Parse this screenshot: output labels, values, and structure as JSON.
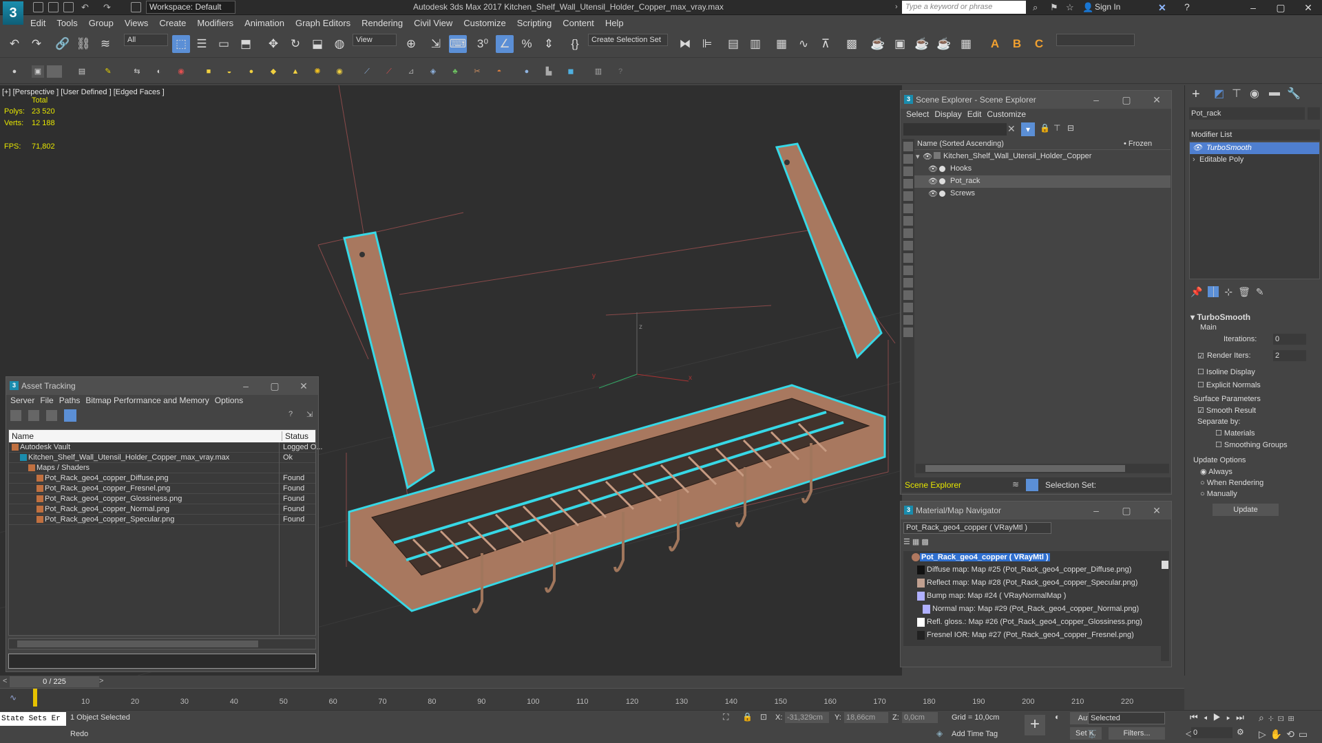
{
  "titlebar": {
    "workspace": "Workspace: Default",
    "title": "Autodesk 3ds Max 2017     Kitchen_Shelf_Wall_Utensil_Holder_Copper_max_vray.max",
    "search_placeholder": "Type a keyword or phrase",
    "signin": "Sign In"
  },
  "menu": [
    "Edit",
    "Tools",
    "Group",
    "Views",
    "Create",
    "Modifiers",
    "Animation",
    "Graph Editors",
    "Rendering",
    "Civil View",
    "Customize",
    "Scripting",
    "Content",
    "Help"
  ],
  "toolbar": {
    "filter": "All",
    "ref_coord": "View",
    "selection_set": "Create Selection Set"
  },
  "viewport": {
    "label": "[+] [Perspective ] [User Defined ] [Edged Faces ]",
    "total_label": "Total",
    "polys_label": "Polys:",
    "polys_value": "23 520",
    "verts_label": "Verts:",
    "verts_value": "12 188",
    "fps_label": "FPS:",
    "fps_value": "71,802"
  },
  "asset_tracking": {
    "title": "Asset Tracking",
    "menus": [
      "Server",
      "File",
      "Paths",
      "Bitmap Performance and Memory",
      "Options"
    ],
    "col_name": "Name",
    "col_status": "Status",
    "rows": [
      {
        "indent": 0,
        "name": "Autodesk Vault",
        "status": "Logged O..."
      },
      {
        "indent": 1,
        "name": "Kitchen_Shelf_Wall_Utensil_Holder_Copper_max_vray.max",
        "status": "Ok"
      },
      {
        "indent": 2,
        "name": "Maps / Shaders",
        "status": ""
      },
      {
        "indent": 3,
        "name": "Pot_Rack_geo4_copper_Diffuse.png",
        "status": "Found"
      },
      {
        "indent": 3,
        "name": "Pot_Rack_geo4_copper_Fresnel.png",
        "status": "Found"
      },
      {
        "indent": 3,
        "name": "Pot_Rack_geo4_copper_Glossiness.png",
        "status": "Found"
      },
      {
        "indent": 3,
        "name": "Pot_Rack_geo4_copper_Normal.png",
        "status": "Found"
      },
      {
        "indent": 3,
        "name": "Pot_Rack_geo4_copper_Specular.png",
        "status": "Found"
      }
    ]
  },
  "scene_explorer": {
    "title": "Scene Explorer - Scene Explorer",
    "menus": [
      "Select",
      "Display",
      "Edit",
      "Customize"
    ],
    "col_name": "Name (Sorted Ascending)",
    "col_frozen": "• Frozen",
    "root": "Kitchen_Shelf_Wall_Utensil_Holder_Copper",
    "children": [
      "Hooks",
      "Pot_rack",
      "Screws"
    ],
    "footer_name": "Scene Explorer",
    "selection_set_label": "Selection Set:"
  },
  "material_nav": {
    "title": "Material/Map Navigator",
    "current": "Pot_Rack_geo4_copper  ( VRayMtl )",
    "root": "Pot_Rack_geo4_copper  ( VRayMtl )",
    "items": [
      "Diffuse map: Map #25 (Pot_Rack_geo4_copper_Diffuse.png)",
      "Reflect map: Map #28 (Pot_Rack_geo4_copper_Specular.png)",
      "Bump map: Map #24  ( VRayNormalMap )",
      "Normal map: Map #29 (Pot_Rack_geo4_copper_Normal.png)",
      "Refl. gloss.: Map #26 (Pot_Rack_geo4_copper_Glossiness.png)",
      "Fresnel IOR: Map #27 (Pot_Rack_geo4_copper_Fresnel.png)"
    ]
  },
  "command_panel": {
    "object_name": "Pot_rack",
    "modifier_list": "Modifier List",
    "stack": [
      "TurboSmooth",
      "Editable Poly"
    ],
    "rollout": "TurboSmooth",
    "main": "Main",
    "iterations_label": "Iterations:",
    "iterations_value": "0",
    "render_iters_label": "Render Iters:",
    "render_iters_value": "2",
    "isoline": "Isoline Display",
    "explicit": "Explicit Normals",
    "surface_params": "Surface Parameters",
    "smooth_result": "Smooth Result",
    "separate_by": "Separate by:",
    "materials": "Materials",
    "smoothing_groups": "Smoothing Groups",
    "update_options": "Update Options",
    "always": "Always",
    "when_rendering": "When Rendering",
    "manually": "Manually",
    "update_btn": "Update"
  },
  "timeline": {
    "frame": "0 / 225",
    "ticks": [
      "10",
      "20",
      "30",
      "40",
      "50",
      "60",
      "70",
      "80",
      "90",
      "100",
      "110",
      "120",
      "130",
      "140",
      "150",
      "160",
      "170",
      "180",
      "190",
      "200",
      "210",
      "220"
    ]
  },
  "status": {
    "state_sets": "State Sets Er",
    "selected": "1 Object Selected",
    "prompt": "Redo",
    "x_label": "X:",
    "x_value": "-31,329cm",
    "y_label": "Y:",
    "y_value": "18,66cm",
    "z_label": "Z:",
    "z_value": "0,0cm",
    "grid": "Grid = 10,0cm",
    "add_time_tag": "Add Time Tag",
    "auto": "Auto",
    "set_key": "Set K.",
    "selected_dd": "Selected",
    "filters": "Filters...",
    "frame_field": "0"
  },
  "colors": {
    "accent": "#5b8fd6",
    "selection_outline": "#37d8e6",
    "copper": "#a8785f",
    "stat_yellow": "#e6e600"
  }
}
